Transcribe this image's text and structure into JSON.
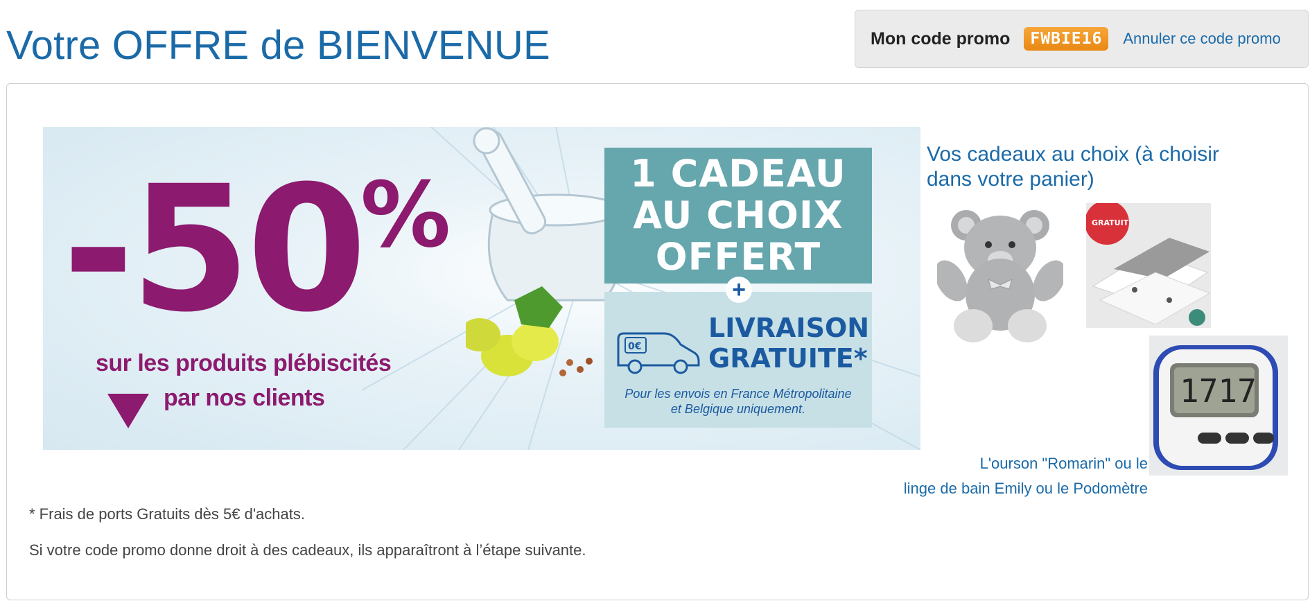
{
  "header": {
    "title": "Votre OFFRE de BIENVENUE"
  },
  "promo": {
    "label": "Mon code promo",
    "code": "FWBIE16",
    "cancel_link": "Annuler ce code promo",
    "code_color": "#f39a22"
  },
  "banner": {
    "discount": "-50",
    "percent_sign": "%",
    "subline1": "sur les produits plébiscités",
    "subline2": "par nos clients",
    "gift_lines": [
      "1 CADEAU",
      "AU CHOIX",
      "OFFERT"
    ],
    "plus": "+",
    "delivery_line1": "LIVRAISON",
    "delivery_line2": "GRATUITE*",
    "van_price": "0€",
    "delivery_note1": "Pour les envois en France  Métropolitaine",
    "delivery_note2": "et Belgique uniquement.",
    "accent_color": "#8c1a6e",
    "teal_color": "#66a6ad"
  },
  "gifts": {
    "heading": "Vos cadeaux au choix (à choisir dans votre panier)",
    "caption_line1": "L'ourson \"Romarin\" ou le",
    "caption_line2": "linge de bain Emily ou le Podomètre",
    "items": [
      {
        "name": "teddy-bear-image"
      },
      {
        "name": "towel-image",
        "badge_text": "GRATUIT"
      },
      {
        "name": "pedometer-image",
        "display": "1717"
      }
    ]
  },
  "footer": {
    "footnote": "* Frais de ports Gratuits dès 5€ d'achats.",
    "info": "Si votre code promo donne droit à des cadeaux, ils apparaîtront à l’étape suivante."
  }
}
